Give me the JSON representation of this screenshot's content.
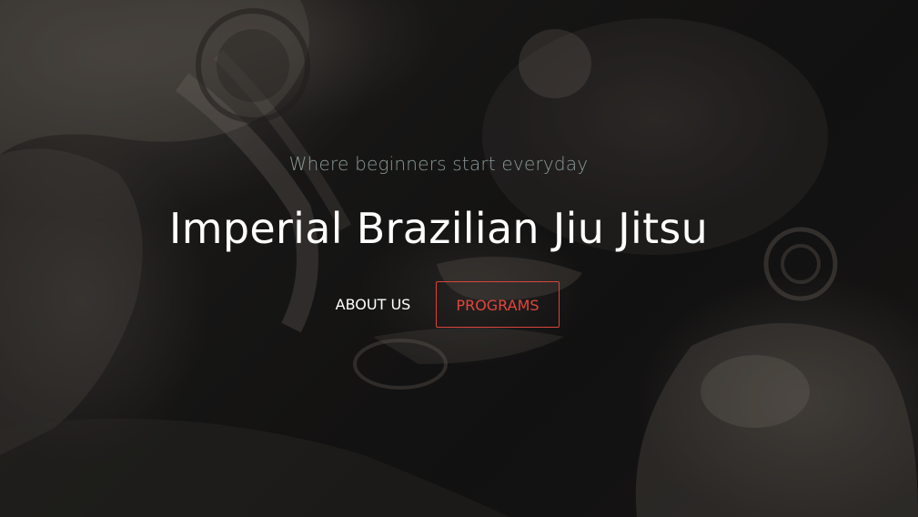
{
  "hero": {
    "tagline": "Where beginners start everyday",
    "title": "Imperial Brazilian Jiu Jitsu",
    "background_image": "grappling-photo",
    "about_label": "ABOUT US",
    "programs_label": "PROGRAMS"
  },
  "colors": {
    "accent": "#e2463d",
    "tagline": "#8a9a98",
    "title": "#ffffff"
  }
}
